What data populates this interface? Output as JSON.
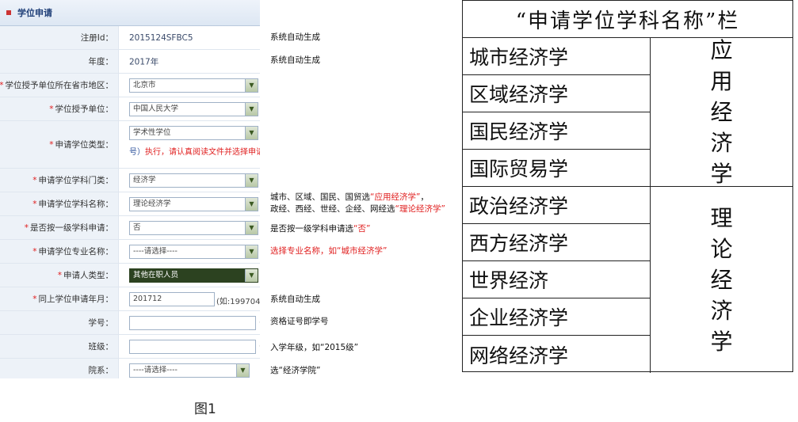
{
  "form": {
    "header": "学位申请",
    "rows": [
      {
        "label": "注册Id：",
        "required": false,
        "type": "text",
        "value": "2015124SFBC5"
      },
      {
        "label": "年度：",
        "required": false,
        "type": "text",
        "value": "2017年"
      },
      {
        "label": "学位授予单位所在省市地区：",
        "required": true,
        "type": "select",
        "value": "北京市"
      },
      {
        "label": "学位授予单位：",
        "required": true,
        "type": "select",
        "value": "中国人民大学"
      },
      {
        "label": "申请学位类型：",
        "required": true,
        "type": "select",
        "value": "学术性学位",
        "notice_blue": "号）",
        "notice": "执行，请认真阅读文件并选择申请"
      },
      {
        "label": "申请学位学科门类：",
        "required": true,
        "type": "select",
        "value": "经济学"
      },
      {
        "label": "申请学位学科名称：",
        "required": true,
        "type": "select",
        "value": "理论经济学"
      },
      {
        "label": "是否按一级学科申请：",
        "required": true,
        "type": "select",
        "value": "否"
      },
      {
        "label": "申请学位专业名称：",
        "required": true,
        "type": "select",
        "value": "----请选择----"
      },
      {
        "label": "申请人类型：",
        "required": true,
        "type": "select-dark",
        "value": "其他在职人员"
      },
      {
        "label": "同上学位申请年月：",
        "required": true,
        "type": "input",
        "value": "201712",
        "suffix": "(如:199704"
      },
      {
        "label": "学号：",
        "required": false,
        "type": "input",
        "value": "",
        "suffix": "("
      },
      {
        "label": "班级：",
        "required": false,
        "type": "input",
        "value": "",
        "suffix": "("
      },
      {
        "label": "院系：",
        "required": false,
        "type": "select",
        "value": "----请选择----"
      }
    ]
  },
  "notes": {
    "n1": "系统自动生成",
    "n2": "系统自动生成",
    "n3a_pre": "城市、区域、国民、国贸选",
    "n3a_red": "“应用经济学”",
    "n3a_post": "，",
    "n3b_pre": "政经、西经、世经、企经、网经选",
    "n3b_red": "“理论经济学”",
    "n4_pre": "是否按一级学科申请选",
    "n4_red": "“否”",
    "n5": "选择专业名称，如“城市经济学”",
    "n6": "系统自动生成",
    "n7": "资格证号即学号",
    "n8": "入学年级，如“2015级”",
    "n9": "选“经济学院”"
  },
  "table": {
    "title": "“申请学位学科名称”栏",
    "subjects": [
      "城市经济学",
      "区域经济学",
      "国民经济学",
      "国际贸易学",
      "政治经济学",
      "西方经济学",
      "世界经济",
      "企业经济学",
      "网络经济学"
    ],
    "group1": "应用经济学",
    "group2": "理论经济学"
  },
  "caption": "图1",
  "colors": {
    "required": "#e02020",
    "header_text": "#1f3f78",
    "label_bg": "#edf2f8"
  }
}
